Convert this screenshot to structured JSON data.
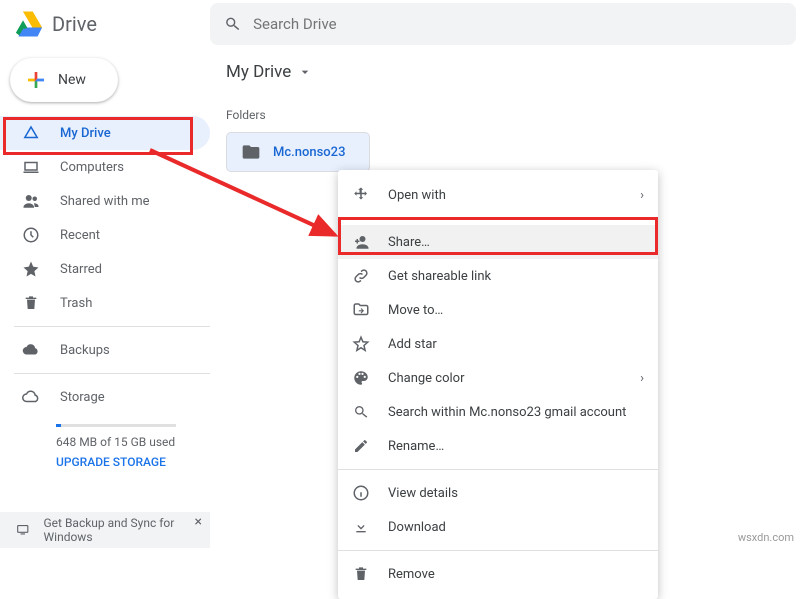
{
  "header": {
    "app_name": "Drive",
    "search_placeholder": "Search Drive"
  },
  "sidebar": {
    "new_label": "New",
    "items": [
      {
        "label": "My Drive"
      },
      {
        "label": "Computers"
      },
      {
        "label": "Shared with me"
      },
      {
        "label": "Recent"
      },
      {
        "label": "Starred"
      },
      {
        "label": "Trash"
      }
    ],
    "backups_label": "Backups",
    "storage_label": "Storage",
    "storage_used": "648 MB of 15 GB used",
    "storage_pct": 4.3,
    "upgrade_label": "UPGRADE STORAGE"
  },
  "promo": {
    "text": "Get Backup and Sync for Windows"
  },
  "content": {
    "breadcrumb": "My Drive",
    "section_label": "Folders",
    "folder_name": "Mc.nonso23"
  },
  "menu": {
    "items": [
      {
        "label": "Open with",
        "submenu": true
      },
      {
        "label": "Share…"
      },
      {
        "label": "Get shareable link"
      },
      {
        "label": "Move to…"
      },
      {
        "label": "Add star"
      },
      {
        "label": "Change color",
        "submenu": true
      },
      {
        "label": "Search within Mc.nonso23 gmail account"
      },
      {
        "label": "Rename…"
      },
      {
        "label": "View details"
      },
      {
        "label": "Download"
      },
      {
        "label": "Remove"
      }
    ]
  },
  "watermark": "wsxdn.com"
}
